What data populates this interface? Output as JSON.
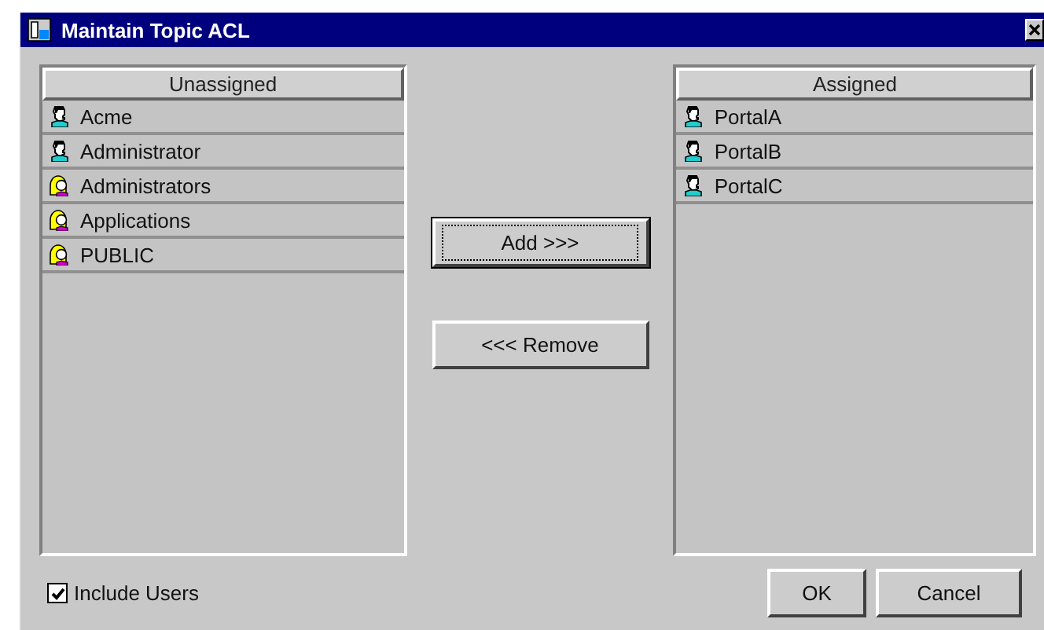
{
  "window": {
    "title": "Maintain Topic ACL"
  },
  "unassigned": {
    "header": "Unassigned",
    "items": [
      {
        "label": "Acme",
        "kind": "user"
      },
      {
        "label": "Administrator",
        "kind": "user"
      },
      {
        "label": "Administrators",
        "kind": "group"
      },
      {
        "label": "Applications",
        "kind": "group"
      },
      {
        "label": "PUBLIC",
        "kind": "group"
      }
    ]
  },
  "buttons_middle": [
    {
      "label": "Add >>>",
      "focused": true
    },
    {
      "label": "<<< Remove",
      "focused": false
    }
  ],
  "assigned": {
    "header": "Assigned",
    "items": [
      {
        "label": "PortalA",
        "kind": "user"
      },
      {
        "label": "PortalB",
        "kind": "user"
      },
      {
        "label": "PortalC",
        "kind": "user"
      }
    ]
  },
  "include_users": {
    "label": "Include Users",
    "checked": true
  },
  "buttons_bottom": [
    "OK",
    "Cancel"
  ]
}
